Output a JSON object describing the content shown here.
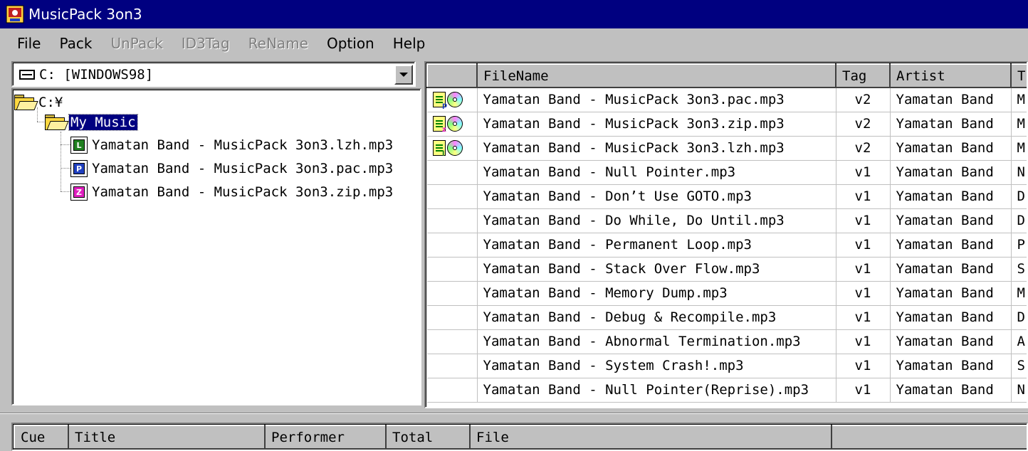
{
  "window": {
    "title": "MusicPack 3on3"
  },
  "menu": [
    {
      "label": "File",
      "enabled": true
    },
    {
      "label": "Pack",
      "enabled": true
    },
    {
      "label": "UnPack",
      "enabled": false
    },
    {
      "label": "ID3Tag",
      "enabled": false
    },
    {
      "label": "ReName",
      "enabled": false
    },
    {
      "label": "Option",
      "enabled": true
    },
    {
      "label": "Help",
      "enabled": true
    }
  ],
  "drive": {
    "label": "C: [WINDOWS98]",
    "icon": "drive-icon"
  },
  "tree": {
    "root": "C:¥",
    "folder": "My Music",
    "files": [
      {
        "name": "Yamatan Band - MusicPack 3on3.lzh.mp3",
        "badge": "L",
        "color": "#208020"
      },
      {
        "name": "Yamatan Band - MusicPack 3on3.pac.mp3",
        "badge": "P",
        "color": "#2040c0"
      },
      {
        "name": "Yamatan Band - MusicPack 3on3.zip.mp3",
        "badge": "Z",
        "color": "#e020c0"
      }
    ]
  },
  "list": {
    "columns": [
      "",
      "FileName",
      "Tag",
      "Artist",
      "T"
    ],
    "rows": [
      {
        "icons": "p",
        "file": "Yamatan Band - MusicPack 3on3.pac.mp3",
        "tag": "v2",
        "artist": "Yamatan Band",
        "t": "M"
      },
      {
        "icons": "z",
        "file": "Yamatan Band - MusicPack 3on3.zip.mp3",
        "tag": "v2",
        "artist": "Yamatan Band",
        "t": "M"
      },
      {
        "icons": "l",
        "file": "Yamatan Band - MusicPack 3on3.lzh.mp3",
        "tag": "v2",
        "artist": "Yamatan Band",
        "t": "M"
      },
      {
        "icons": "",
        "file": "Yamatan Band - Null Pointer.mp3",
        "tag": "v1",
        "artist": "Yamatan Band",
        "t": "N"
      },
      {
        "icons": "",
        "file": "Yamatan Band - Don’t Use GOTO.mp3",
        "tag": "v1",
        "artist": "Yamatan Band",
        "t": "D"
      },
      {
        "icons": "",
        "file": "Yamatan Band - Do While, Do Until.mp3",
        "tag": "v1",
        "artist": "Yamatan Band",
        "t": "D"
      },
      {
        "icons": "",
        "file": "Yamatan Band - Permanent Loop.mp3",
        "tag": "v1",
        "artist": "Yamatan Band",
        "t": "P"
      },
      {
        "icons": "",
        "file": "Yamatan Band - Stack Over Flow.mp3",
        "tag": "v1",
        "artist": "Yamatan Band",
        "t": "S"
      },
      {
        "icons": "",
        "file": "Yamatan Band - Memory Dump.mp3",
        "tag": "v1",
        "artist": "Yamatan Band",
        "t": "M"
      },
      {
        "icons": "",
        "file": "Yamatan Band - Debug & Recompile.mp3",
        "tag": "v1",
        "artist": "Yamatan Band",
        "t": "D"
      },
      {
        "icons": "",
        "file": "Yamatan Band - Abnormal Termination.mp3",
        "tag": "v1",
        "artist": "Yamatan Band",
        "t": "A"
      },
      {
        "icons": "",
        "file": "Yamatan Band - System Crash!.mp3",
        "tag": "v1",
        "artist": "Yamatan Band",
        "t": "S"
      },
      {
        "icons": "",
        "file": "Yamatan Band - Null Pointer(Reprise).mp3",
        "tag": "v1",
        "artist": "Yamatan Band",
        "t": "N"
      }
    ]
  },
  "cue": {
    "columns": [
      "Cue",
      "Title",
      "Performer",
      "Total",
      "File",
      ""
    ]
  },
  "colors": {
    "titlebar": "#000080",
    "face": "#c0c0c0",
    "selection": "#000080"
  }
}
